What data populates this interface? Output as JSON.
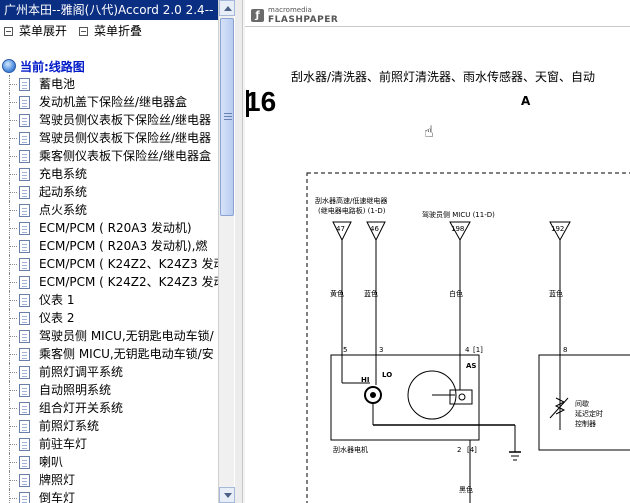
{
  "window_title": "广州本田--雅阁(八代)Accord 2.0 2.4--",
  "toolbar": {
    "expand_label": "菜单展开",
    "collapse_label": "菜单折叠"
  },
  "tree": {
    "root_label": "当前:线路图",
    "items": [
      "蓄电池",
      "发动机盖下保险丝/继电器盒",
      "驾驶员侧仪表板下保险丝/继电器",
      "驾驶员侧仪表板下保险丝/继电器",
      "乘客侧仪表板下保险丝/继电器盒",
      "充电系统",
      "起动系统",
      "点火系统",
      "ECM/PCM ( R20A3 发动机)",
      "ECM/PCM ( R20A3 发动机),燃",
      "ECM/PCM ( K24Z2、K24Z3 发动",
      "ECM/PCM ( K24Z2、K24Z3 发动",
      "仪表 1",
      "仪表 2",
      "驾驶员侧 MICU,无钥匙电动车锁/",
      "乘客侧 MICU,无钥匙电动车锁/安",
      "前照灯调平系统",
      "自动照明系统",
      "组合灯开关系统",
      "前照灯系统",
      "前驻车灯",
      "喇叭",
      "牌照灯",
      "倒车灯"
    ]
  },
  "viewer": {
    "logo_small": "macromedia",
    "logo_big": "FLASHPAPER",
    "doc_title": "刮水器/清洗器、前照灯清洗器、雨水传感器、天窗、自动",
    "page_number": "16",
    "section": "A",
    "diagram": {
      "conn1_note_line1": "刮水器高速/低速继电器",
      "conn1_note_line2": "(继电器电路板) (1-D)",
      "conn2_note": "驾驶员侧 MICU (11-D)",
      "conn_47": "47",
      "conn_46": "46",
      "conn_198": "198",
      "conn_192": "192",
      "wire_yellow": "黄色",
      "wire_blue": "蓝色",
      "wire_white": "白色",
      "wire_blue2": "蓝色",
      "pin5": "5",
      "pin3": "3",
      "pin4": "4",
      "pin4b": "[1]",
      "pin8": "8",
      "hi": "HI",
      "lo": "LO",
      "as": "AS",
      "motor_label": "刮水器电机",
      "pin2": "2",
      "pin2b": "[4]",
      "ground_wire": "黑色",
      "ctrl_line1": "间歇",
      "ctrl_line2": "延迟定时",
      "ctrl_line3": "控制器"
    }
  }
}
